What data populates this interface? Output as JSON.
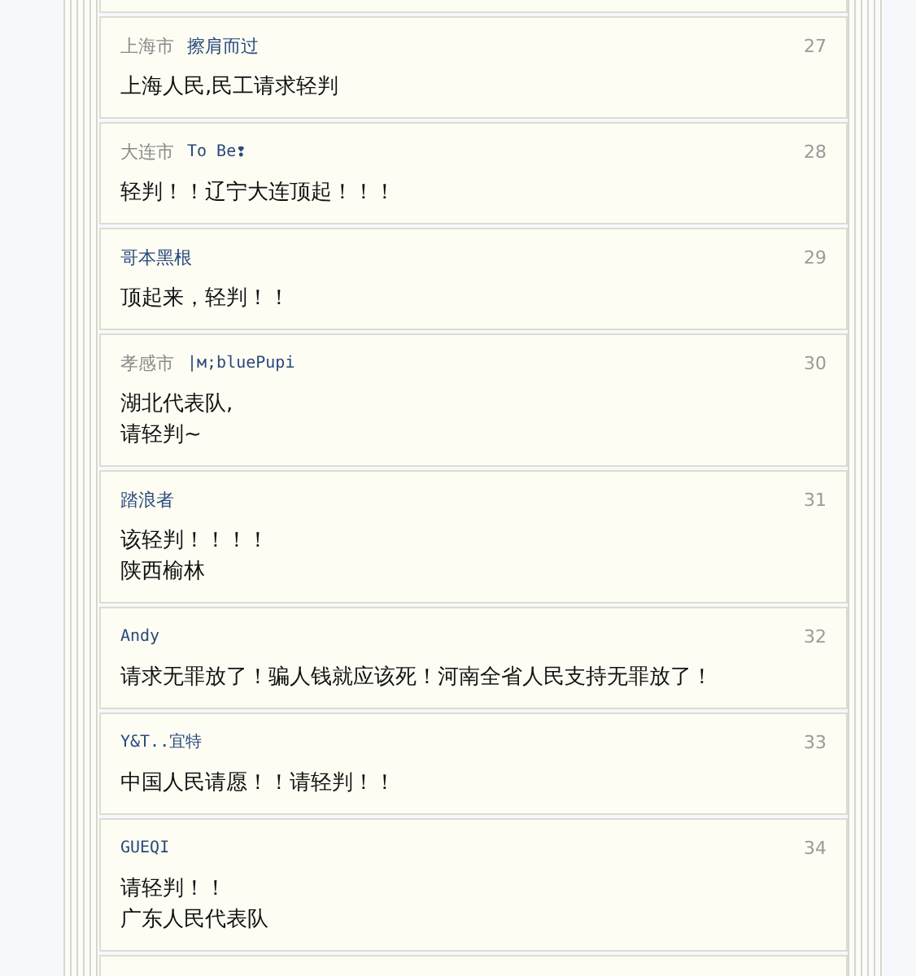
{
  "comments": [
    {
      "location": "上海市",
      "user": "擦肩而过",
      "user_mono": false,
      "number": "27",
      "lines": [
        "上海人民,民工请求轻判"
      ]
    },
    {
      "location": "大连市",
      "user": "To Be❢",
      "user_mono": true,
      "number": "28",
      "lines": [
        "轻判！！辽宁大连顶起！！！"
      ]
    },
    {
      "user": "哥本黑根",
      "user_mono": false,
      "number": "29",
      "lines": [
        "顶起来，轻判！！"
      ]
    },
    {
      "location": "孝感市",
      "user": "|м;bluePupi",
      "user_mono": true,
      "number": "30",
      "lines": [
        "湖北代表队,",
        "请轻判~"
      ]
    },
    {
      "user": "踏浪者",
      "user_mono": false,
      "number": "31",
      "lines": [
        "该轻判！！！！",
        "陕西榆林"
      ]
    },
    {
      "user": "Andy",
      "user_mono": true,
      "number": "32",
      "lines": [
        "请求无罪放了！骗人钱就应该死！河南全省人民支持无罪放了！"
      ]
    },
    {
      "user": "Y&T..宜特",
      "user_mono": true,
      "number": "33",
      "lines": [
        "中国人民请愿！！请轻判！！"
      ]
    },
    {
      "user": "GUEQI",
      "user_mono": true,
      "number": "34",
      "lines": [
        "请轻判！！",
        "广东人民代表队"
      ]
    }
  ]
}
